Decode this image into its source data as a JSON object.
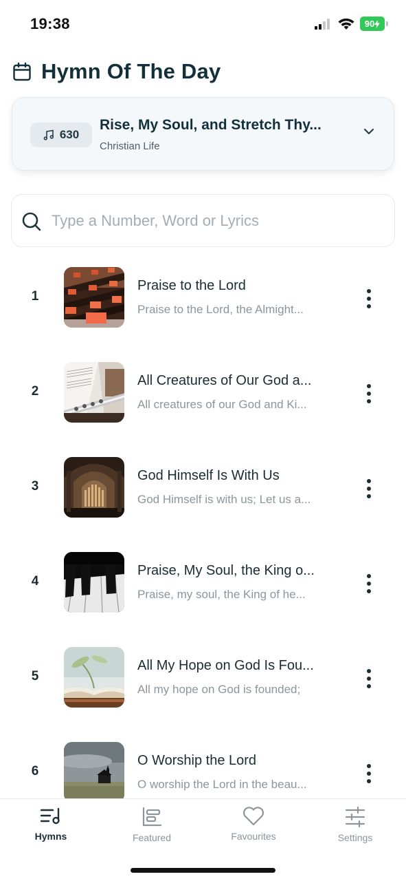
{
  "status_bar": {
    "time": "19:38",
    "battery": "90",
    "icons": [
      "cellular-signal-icon",
      "wifi-icon",
      "battery-charging-icon"
    ]
  },
  "header": {
    "title": "Hymn Of The Day",
    "icon": "calendar-icon"
  },
  "hymn_of_day": {
    "number": "630",
    "title": "Rise, My Soul, and Stretch Thy...",
    "category": "Christian Life",
    "badge_icon": "music-note-icon",
    "expand_icon": "chevron-down-icon"
  },
  "search": {
    "placeholder": "Type a Number, Word or Lyrics",
    "value": ""
  },
  "hymns": [
    {
      "number": "1",
      "title": "Praise to the Lord",
      "lyric": "Praise to the Lord, the Almight...",
      "thumbnail": "church-pews-image"
    },
    {
      "number": "2",
      "title": "All Creatures of Our God a...",
      "lyric": "All creatures of our God and Ki...",
      "thumbnail": "flute-sheet-music-image"
    },
    {
      "number": "3",
      "title": "God Himself Is With Us",
      "lyric": "God Himself is with us; Let us a...",
      "thumbnail": "cathedral-organ-image"
    },
    {
      "number": "4",
      "title": "Praise, My Soul, the King o...",
      "lyric": "Praise, my soul, the King of he...",
      "thumbnail": "piano-keys-image"
    },
    {
      "number": "5",
      "title": "All My Hope on God Is Fou...",
      "lyric": "All my hope on God is founded;",
      "thumbnail": "open-bible-plant-image"
    },
    {
      "number": "6",
      "title": "O Worship the Lord",
      "lyric": "O worship the Lord in the beau...",
      "thumbnail": "chapel-landscape-image"
    }
  ],
  "tabs": [
    {
      "label": "Hymns",
      "icon": "hymn-list-icon",
      "active": true
    },
    {
      "label": "Featured",
      "icon": "featured-icon",
      "active": false
    },
    {
      "label": "Favourites",
      "icon": "heart-icon",
      "active": false
    },
    {
      "label": "Settings",
      "icon": "sliders-icon",
      "active": false
    }
  ],
  "colors": {
    "title": "#13303a",
    "card_bg": "#f5f8fa",
    "muted_text": "#8b969c",
    "battery_green": "#34c759"
  }
}
